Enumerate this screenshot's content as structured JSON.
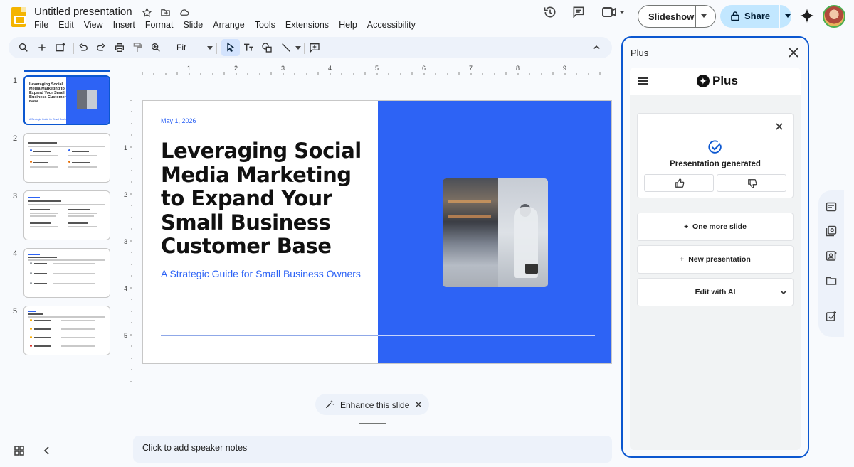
{
  "app": {
    "doc_title": "Untitled presentation",
    "menu": [
      "File",
      "Edit",
      "View",
      "Insert",
      "Format",
      "Slide",
      "Arrange",
      "Tools",
      "Extensions",
      "Help",
      "Accessibility"
    ],
    "slideshow_label": "Slideshow",
    "share_label": "Share"
  },
  "toolbar": {
    "zoom": "Fit"
  },
  "filmstrip": {
    "slides": [
      {
        "num": "1",
        "title": "Leveraging Social Media Marketing to Expand Your Small Business Customer Base",
        "subtitle": "A Strategic Guide for Small Business Owners"
      },
      {
        "num": "2"
      },
      {
        "num": "3"
      },
      {
        "num": "4"
      },
      {
        "num": "5"
      }
    ]
  },
  "ruler": {
    "h": [
      "1",
      "2",
      "3",
      "4",
      "5",
      "6",
      "7",
      "8",
      "9"
    ],
    "v": [
      "1",
      "2",
      "3",
      "4",
      "5"
    ]
  },
  "slide": {
    "date": "May 1, 2026",
    "title": "Leveraging Social Media Marketing to Expand Your Small Business Customer Base",
    "subtitle": "A Strategic Guide for Small Business Owners",
    "accent_color": "#2d63f5"
  },
  "enhance": {
    "label": "Enhance this slide"
  },
  "notes": {
    "placeholder": "Click to add speaker notes"
  },
  "panel": {
    "title": "Plus",
    "brand": "Plus",
    "status": "Presentation generated",
    "actions": [
      {
        "label": "One more slide"
      },
      {
        "label": "New presentation"
      },
      {
        "label": "Edit with AI"
      }
    ]
  }
}
